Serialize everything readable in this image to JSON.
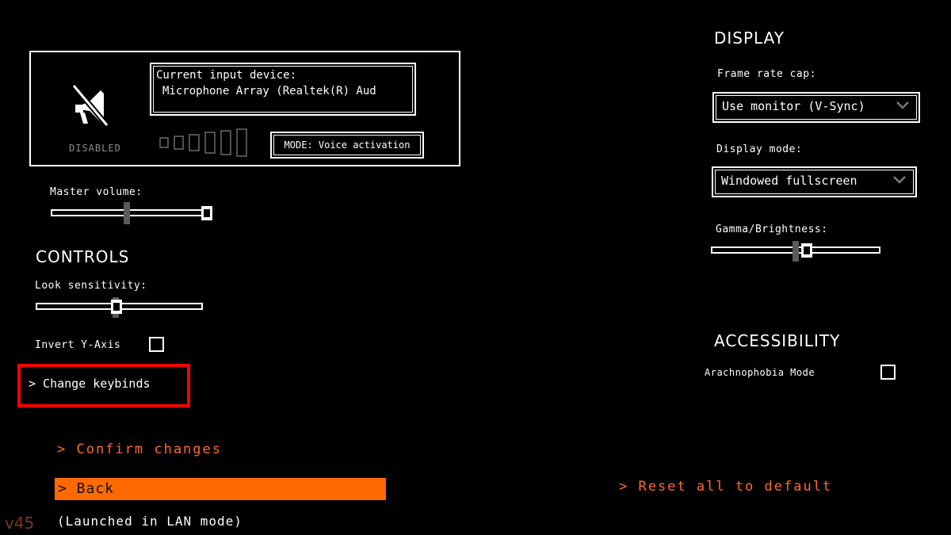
{
  "voice_chat": {
    "status": "DISABLED",
    "device_label": "Current input device:",
    "device_value": "Microphone Array (Realtek(R) Aud",
    "mode_label": "MODE: Voice activation",
    "level": 0
  },
  "master_volume": {
    "label": "Master volume:",
    "value": 1.0,
    "default": 0.47
  },
  "controls": {
    "heading": "CONTROLS",
    "look_sensitivity": {
      "label": "Look sensitivity:",
      "value": 0.48,
      "default": 0.48
    },
    "invert_y": {
      "label": "Invert Y-Axis",
      "checked": false
    },
    "keybinds_label": "> Change keybinds"
  },
  "display": {
    "heading": "DISPLAY",
    "frame_rate_cap": {
      "label": "Frame rate cap:",
      "value": "Use monitor (V-Sync)"
    },
    "display_mode": {
      "label": "Display mode:",
      "value": "Windowed fullscreen"
    },
    "gamma": {
      "label": "Gamma/Brightness:",
      "value": 0.57,
      "default": 0.5
    }
  },
  "accessibility": {
    "heading": "ACCESSIBILITY",
    "arachnophobia": {
      "label": "Arachnophobia Mode",
      "checked": false
    }
  },
  "footer": {
    "confirm_label": "> Confirm changes",
    "back_label": "> Back",
    "reset_label": "> Reset all to default",
    "version": "v45",
    "status": "(Launched in LAN mode)"
  },
  "colors": {
    "background": "#000000",
    "foreground": "#ffffff",
    "accent": "#ff6a00",
    "highlight": "#ff0000"
  }
}
